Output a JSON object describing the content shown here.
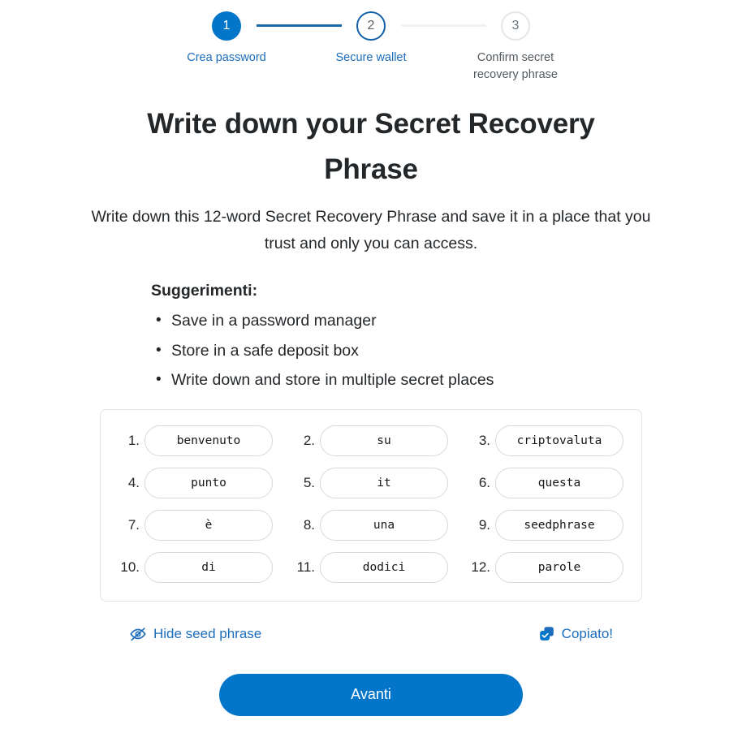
{
  "stepper": {
    "steps": [
      {
        "number": "1",
        "label": "Crea password",
        "state": "done"
      },
      {
        "number": "2",
        "label": "Secure wallet",
        "state": "active"
      },
      {
        "number": "3",
        "label": "Confirm secret recovery phrase",
        "state": "todo"
      }
    ],
    "colors": {
      "done_fill": "#0376c9",
      "active_ring": "#1161a8",
      "todo_ring": "#e5e5e5",
      "connector_filled": "#1a6aa8",
      "connector_empty": "#f2f2f2",
      "label_active": "#1c6dbc",
      "label_inactive": "#535a61"
    }
  },
  "heading": {
    "title": "Write down your Secret Recovery Phrase",
    "subtitle": "Write down this 12-word Secret Recovery Phrase and save it in a place that you trust and only you can access."
  },
  "tips": {
    "title": "Suggerimenti:",
    "items": [
      "Save in a password manager",
      "Store in a safe deposit box",
      "Write down and store in multiple secret places"
    ]
  },
  "seed_phrase": {
    "words": [
      {
        "index": "1.",
        "word": "benvenuto"
      },
      {
        "index": "2.",
        "word": "su"
      },
      {
        "index": "3.",
        "word": "criptovaluta"
      },
      {
        "index": "4.",
        "word": "punto"
      },
      {
        "index": "5.",
        "word": "it"
      },
      {
        "index": "6.",
        "word": "questa"
      },
      {
        "index": "7.",
        "word": "è"
      },
      {
        "index": "8.",
        "word": "una"
      },
      {
        "index": "9.",
        "word": "seedphrase"
      },
      {
        "index": "10.",
        "word": "di"
      },
      {
        "index": "11.",
        "word": "dodici"
      },
      {
        "index": "12.",
        "word": "parole"
      }
    ]
  },
  "actions": {
    "hide_label": "Hide seed phrase",
    "hide_icon": "eye-slash-icon",
    "copy_label": "Copiato!",
    "copy_icon": "copy-check-icon",
    "link_color": "#1c6dbc"
  },
  "footer": {
    "next_label": "Avanti",
    "next_color": "#0376c9"
  }
}
